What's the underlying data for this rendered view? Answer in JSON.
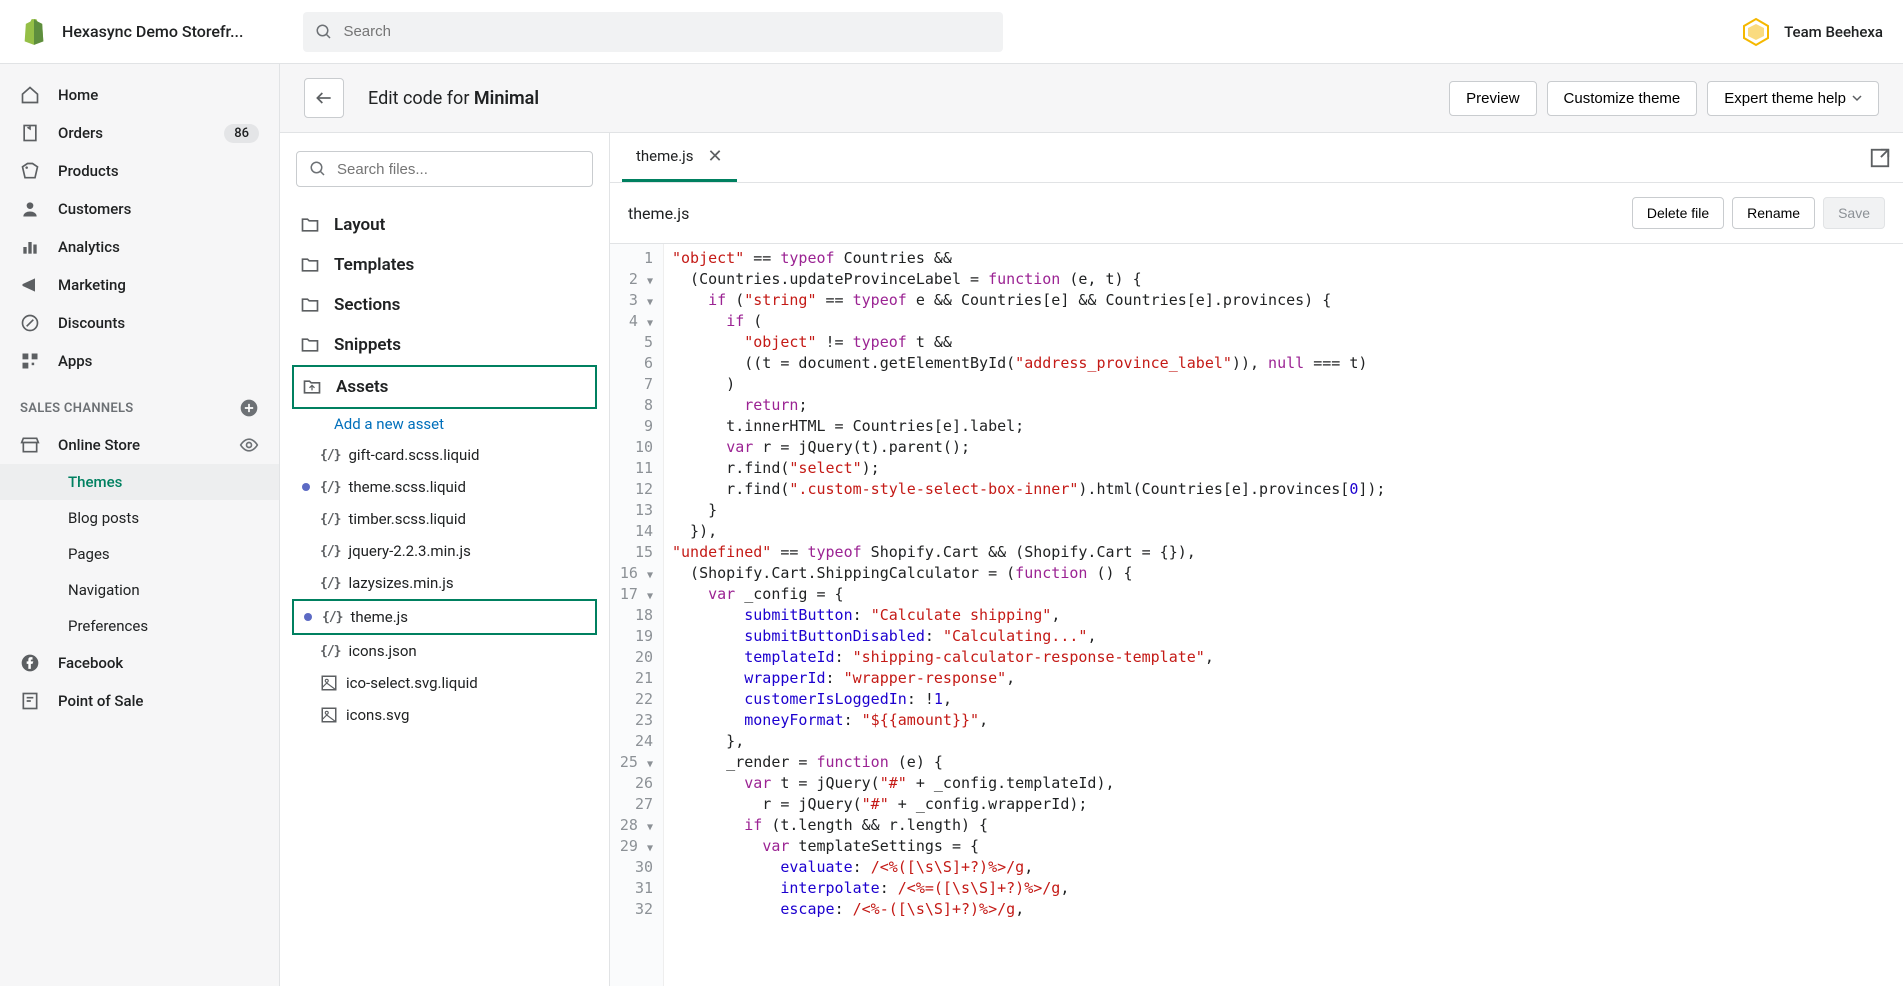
{
  "topbar": {
    "store_name": "Hexasync Demo Storefr...",
    "search_placeholder": "Search",
    "team_label": "Team Beehexa"
  },
  "nav": {
    "items": [
      {
        "label": "Home",
        "icon": "home"
      },
      {
        "label": "Orders",
        "icon": "orders",
        "badge": "86"
      },
      {
        "label": "Products",
        "icon": "products"
      },
      {
        "label": "Customers",
        "icon": "customers"
      },
      {
        "label": "Analytics",
        "icon": "analytics"
      },
      {
        "label": "Marketing",
        "icon": "marketing"
      },
      {
        "label": "Discounts",
        "icon": "discounts"
      },
      {
        "label": "Apps",
        "icon": "apps"
      }
    ],
    "section_label": "SALES CHANNELS",
    "channels": [
      {
        "label": "Online Store",
        "icon": "store",
        "eye": true
      },
      {
        "label": "Themes",
        "sub": true,
        "active": true
      },
      {
        "label": "Blog posts",
        "sub": true
      },
      {
        "label": "Pages",
        "sub": true
      },
      {
        "label": "Navigation",
        "sub": true
      },
      {
        "label": "Preferences",
        "sub": true
      },
      {
        "label": "Facebook",
        "icon": "facebook"
      },
      {
        "label": "Point of Sale",
        "icon": "pos"
      }
    ]
  },
  "header": {
    "title_prefix": "Edit code for ",
    "title_bold": "Minimal",
    "buttons": {
      "preview": "Preview",
      "customize": "Customize theme",
      "expert": "Expert theme help"
    }
  },
  "tree": {
    "search_placeholder": "Search files...",
    "folders": [
      "Layout",
      "Templates",
      "Sections",
      "Snippets",
      "Assets"
    ],
    "add_asset": "Add a new asset",
    "files": [
      {
        "name": "gift-card.scss.liquid",
        "type": "code"
      },
      {
        "name": "theme.scss.liquid",
        "type": "code",
        "modified": true
      },
      {
        "name": "timber.scss.liquid",
        "type": "code"
      },
      {
        "name": "jquery-2.2.3.min.js",
        "type": "code"
      },
      {
        "name": "lazysizes.min.js",
        "type": "code"
      },
      {
        "name": "theme.js",
        "type": "code",
        "modified": true,
        "highlighted": true
      },
      {
        "name": "icons.json",
        "type": "code"
      },
      {
        "name": "ico-select.svg.liquid",
        "type": "img"
      },
      {
        "name": "icons.svg",
        "type": "img"
      }
    ]
  },
  "editor": {
    "tab_name": "theme.js",
    "file_name": "theme.js",
    "actions": {
      "delete": "Delete file",
      "rename": "Rename",
      "save": "Save"
    },
    "lines": [
      "1",
      "2",
      "3",
      "4",
      "5",
      "6",
      "7",
      "8",
      "9",
      "10",
      "11",
      "12",
      "13",
      "14",
      "15",
      "16",
      "17",
      "18",
      "19",
      "20",
      "21",
      "22",
      "23",
      "24",
      "25",
      "26",
      "27",
      "28",
      "29",
      "30",
      "31",
      "32"
    ],
    "fold": [
      2,
      3,
      4,
      16,
      17,
      25,
      28,
      29
    ],
    "code": [
      [
        {
          "c": "t-str",
          "t": "\"object\""
        },
        {
          "t": " == "
        },
        {
          "c": "t-kw",
          "t": "typeof"
        },
        {
          "t": " Countries &&"
        }
      ],
      [
        {
          "t": "  (Countries.updateProvinceLabel = "
        },
        {
          "c": "t-kw",
          "t": "function"
        },
        {
          "t": " (e, t) {"
        }
      ],
      [
        {
          "t": "    "
        },
        {
          "c": "t-kw",
          "t": "if"
        },
        {
          "t": " ("
        },
        {
          "c": "t-str",
          "t": "\"string\""
        },
        {
          "t": " == "
        },
        {
          "c": "t-kw",
          "t": "typeof"
        },
        {
          "t": " e && Countries[e] && Countries[e].provinces) {"
        }
      ],
      [
        {
          "t": "      "
        },
        {
          "c": "t-kw",
          "t": "if"
        },
        {
          "t": " ("
        }
      ],
      [
        {
          "t": "        "
        },
        {
          "c": "t-str",
          "t": "\"object\""
        },
        {
          "t": " != "
        },
        {
          "c": "t-kw",
          "t": "typeof"
        },
        {
          "t": " t &&"
        }
      ],
      [
        {
          "t": "        ((t = document.getElementById("
        },
        {
          "c": "t-str",
          "t": "\"address_province_label\""
        },
        {
          "t": ")), "
        },
        {
          "c": "t-kw",
          "t": "null"
        },
        {
          "t": " === t)"
        }
      ],
      [
        {
          "t": "      )"
        }
      ],
      [
        {
          "t": "        "
        },
        {
          "c": "t-kw",
          "t": "return"
        },
        {
          "t": ";"
        }
      ],
      [
        {
          "t": "      t.innerHTML = Countries[e].label;"
        }
      ],
      [
        {
          "t": "      "
        },
        {
          "c": "t-kw",
          "t": "var"
        },
        {
          "t": " r = jQuery(t).parent();"
        }
      ],
      [
        {
          "t": "      r.find("
        },
        {
          "c": "t-str",
          "t": "\"select\""
        },
        {
          "t": ");"
        }
      ],
      [
        {
          "t": "      r.find("
        },
        {
          "c": "t-str",
          "t": "\".custom-style-select-box-inner\""
        },
        {
          "t": ").html(Countries[e].provinces["
        },
        {
          "c": "t-num",
          "t": "0"
        },
        {
          "t": "]);"
        }
      ],
      [
        {
          "t": "    }"
        }
      ],
      [
        {
          "t": "  }),"
        }
      ],
      [
        {
          "c": "t-str",
          "t": "\"undefined\""
        },
        {
          "t": " == "
        },
        {
          "c": "t-kw",
          "t": "typeof"
        },
        {
          "t": " Shopify.Cart && (Shopify.Cart = {}),"
        }
      ],
      [
        {
          "t": "  (Shopify.Cart.ShippingCalculator = ("
        },
        {
          "c": "t-kw",
          "t": "function"
        },
        {
          "t": " () {"
        }
      ],
      [
        {
          "t": "    "
        },
        {
          "c": "t-kw",
          "t": "var"
        },
        {
          "t": " _config = {"
        }
      ],
      [
        {
          "t": "        "
        },
        {
          "c": "t-prop",
          "t": "submitButton"
        },
        {
          "t": ": "
        },
        {
          "c": "t-str",
          "t": "\"Calculate shipping\""
        },
        {
          "t": ","
        }
      ],
      [
        {
          "t": "        "
        },
        {
          "c": "t-prop",
          "t": "submitButtonDisabled"
        },
        {
          "t": ": "
        },
        {
          "c": "t-str",
          "t": "\"Calculating...\""
        },
        {
          "t": ","
        }
      ],
      [
        {
          "t": "        "
        },
        {
          "c": "t-prop",
          "t": "templateId"
        },
        {
          "t": ": "
        },
        {
          "c": "t-str",
          "t": "\"shipping-calculator-response-template\""
        },
        {
          "t": ","
        }
      ],
      [
        {
          "t": "        "
        },
        {
          "c": "t-prop",
          "t": "wrapperId"
        },
        {
          "t": ": "
        },
        {
          "c": "t-str",
          "t": "\"wrapper-response\""
        },
        {
          "t": ","
        }
      ],
      [
        {
          "t": "        "
        },
        {
          "c": "t-prop",
          "t": "customerIsLoggedIn"
        },
        {
          "t": ": !"
        },
        {
          "c": "t-num",
          "t": "1"
        },
        {
          "t": ","
        }
      ],
      [
        {
          "t": "        "
        },
        {
          "c": "t-prop",
          "t": "moneyFormat"
        },
        {
          "t": ": "
        },
        {
          "c": "t-str",
          "t": "\"${{amount}}\""
        },
        {
          "t": ","
        }
      ],
      [
        {
          "t": "      },"
        }
      ],
      [
        {
          "t": "      _render = "
        },
        {
          "c": "t-kw",
          "t": "function"
        },
        {
          "t": " (e) {"
        }
      ],
      [
        {
          "t": "        "
        },
        {
          "c": "t-kw",
          "t": "var"
        },
        {
          "t": " t = jQuery("
        },
        {
          "c": "t-str",
          "t": "\"#\""
        },
        {
          "t": " + _config.templateId),"
        }
      ],
      [
        {
          "t": "          r = jQuery("
        },
        {
          "c": "t-str",
          "t": "\"#\""
        },
        {
          "t": " + _config.wrapperId);"
        }
      ],
      [
        {
          "t": "        "
        },
        {
          "c": "t-kw",
          "t": "if"
        },
        {
          "t": " (t.length && r.length) {"
        }
      ],
      [
        {
          "t": "          "
        },
        {
          "c": "t-kw",
          "t": "var"
        },
        {
          "t": " templateSettings = {"
        }
      ],
      [
        {
          "t": "            "
        },
        {
          "c": "t-prop",
          "t": "evaluate"
        },
        {
          "t": ": "
        },
        {
          "c": "t-rx",
          "t": "/<%([\\s\\S]+?)%>/g"
        },
        {
          "t": ","
        }
      ],
      [
        {
          "t": "            "
        },
        {
          "c": "t-prop",
          "t": "interpolate"
        },
        {
          "t": ": "
        },
        {
          "c": "t-rx",
          "t": "/<%=([\\s\\S]+?)%>/g"
        },
        {
          "t": ","
        }
      ],
      [
        {
          "t": "            "
        },
        {
          "c": "t-prop",
          "t": "escape"
        },
        {
          "t": ": "
        },
        {
          "c": "t-rx",
          "t": "/<%-([\\s\\S]+?)%>/g"
        },
        {
          "t": ","
        }
      ]
    ]
  }
}
